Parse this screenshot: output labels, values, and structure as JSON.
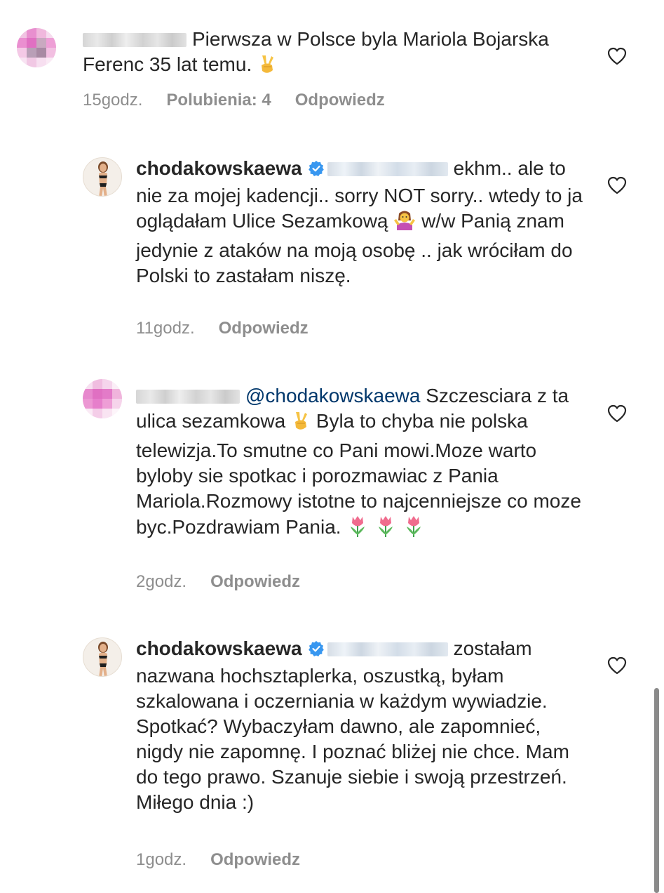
{
  "comments": [
    {
      "author": "",
      "author_blurred": true,
      "verified": false,
      "text": "Pierwsza w Polsce byla Mariola Bojarska Ferenc 35 lat temu.",
      "time": "15godz.",
      "likes": "Polubienia: 4",
      "reply": "Odpowiedz"
    },
    {
      "author": "chodakowskaewa",
      "verified": true,
      "text": "ekhm.. ale to nie za mojej kadencji.. sorry NOT sorry.. wtedy to ja oglądałam Ulice Sezamkową",
      "text2": "w/w Panią znam jedynie z ataków na moją osobę .. jak wróciłam do Polski to zastałam niszę.",
      "time": "11godz.",
      "reply": "Odpowiedz"
    },
    {
      "author": "",
      "author_blurred": true,
      "verified": false,
      "mention": "@chodakowskaewa",
      "text": "Szczesciara z ta ulica sezamkowa",
      "text2": "Byla to chyba nie polska telewizja.To smutne co Pani mowi.Moze warto byloby sie spotkac i porozmawiac z Pania Mariola.Rozmowy istotne to najcenniejsze co moze byc.Pozdrawiam Pania.",
      "time": "2godz.",
      "reply": "Odpowiedz"
    },
    {
      "author": "chodakowskaewa",
      "verified": true,
      "text": "zostałam nazwana hochsztaplerka, oszustką, byłam szkalowana i oczerniania w każdym wywiadzie. Spotkać? Wybaczyłam dawno, ale zapomnieć, nigdy nie zapomnę. I poznać bliżej nie chce. Mam do tego prawo. Szanuje siebie i swoją przestrzeń. Miłego dnia :)",
      "time": "1godz.",
      "reply": "Odpowiedz"
    }
  ],
  "icons": [
    "heart-outline-icon",
    "verified-badge-icon",
    "victory-hand-emoji",
    "shrug-emoji",
    "tulip-emoji"
  ],
  "colors": {
    "text": "#262626",
    "meta": "#8e8e8e",
    "mention": "#00376b",
    "verified": "#3897f0"
  }
}
